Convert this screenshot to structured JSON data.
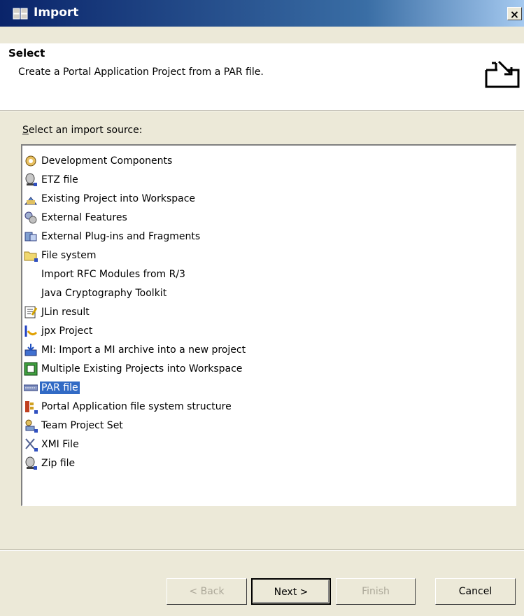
{
  "window": {
    "title": "Import",
    "close_label": "×"
  },
  "header": {
    "title": "Select",
    "description": "Create a Portal Application Project from a PAR file."
  },
  "source": {
    "label_prefix": "S",
    "label_rest": "elect an import source:"
  },
  "items": [
    {
      "label": "Development Components",
      "icon": "development-components-icon"
    },
    {
      "label": "ETZ file",
      "icon": "etz-file-icon"
    },
    {
      "label": "Existing Project into Workspace",
      "icon": "existing-project-icon"
    },
    {
      "label": "External Features",
      "icon": "external-features-icon"
    },
    {
      "label": "External Plug-ins and Fragments",
      "icon": "external-plugins-icon"
    },
    {
      "label": "File system",
      "icon": "folder-icon"
    },
    {
      "label": "Import RFC Modules from R/3",
      "icon": ""
    },
    {
      "label": "Java Cryptography Toolkit",
      "icon": ""
    },
    {
      "label": "JLin result",
      "icon": "jlin-icon"
    },
    {
      "label": "jpx Project",
      "icon": "jpx-project-icon"
    },
    {
      "label": "MI: Import a MI archive into a new project",
      "icon": "mi-archive-icon"
    },
    {
      "label": "Multiple Existing Projects into Workspace",
      "icon": "multiple-projects-icon"
    },
    {
      "label": "PAR file",
      "icon": "par-file-icon",
      "selected": true
    },
    {
      "label": "Portal Application file system structure",
      "icon": "portal-application-icon"
    },
    {
      "label": "Team Project Set",
      "icon": "team-project-set-icon"
    },
    {
      "label": "XMI File",
      "icon": "xmi-file-icon"
    },
    {
      "label": "Zip file",
      "icon": "zip-file-icon"
    }
  ],
  "buttons": {
    "back_label": "< Back",
    "next_label": "Next >",
    "finish_label": "Finish",
    "cancel_label": "Cancel"
  },
  "colors": {
    "selection": "#316ac5",
    "titlebar": "#0a246a",
    "dialog": "#ece9d8"
  }
}
